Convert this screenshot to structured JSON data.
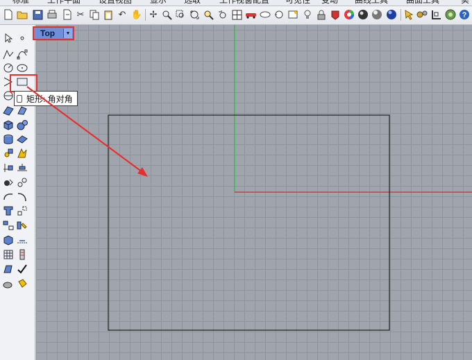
{
  "tabs": [
    "标准",
    "工作平面",
    "设置视图",
    "显示",
    "选取",
    "工作视窗配置",
    "可见性",
    "变动",
    "曲线工具",
    "曲面工具",
    "实"
  ],
  "toolbar_icons": [
    "new-file-icon",
    "open-file-icon",
    "save-icon",
    "print-icon",
    "import-icon",
    "cut-icon",
    "copy-icon",
    "paste-icon",
    "undo-icon",
    "pan-icon",
    "rotate-view-icon",
    "zoom-icon",
    "zoom-window-icon",
    "zoom-extents-icon",
    "zoom-selected-icon",
    "undo-view-icon",
    "four-viewports-icon",
    "car-icon",
    "hide-icon",
    "show-icon",
    "layer-icon",
    "light-icon",
    "lock-icon",
    "material-icon",
    "color-wheel-icon",
    "render-icon",
    "sphere-icon",
    "render-sphere-icon",
    "lightbulb-icon",
    "options-icon",
    "snap-icon",
    "grasshopper-icon",
    "help-icon"
  ],
  "left_toolbar_icons": [
    "select-arrow-icon",
    "point-icon",
    "polyline-icon",
    "control-point-curve-icon",
    "circle-icon",
    "ellipse-icon",
    "arc-icon",
    "rectangle-icon",
    "polygon-icon",
    "sweep-icon",
    "surface-icon",
    "box-icon",
    "sphere-solid-icon",
    "extrude-icon",
    "loft-icon",
    "fillet-icon",
    "boolean-icon",
    "trim-icon",
    "split-icon",
    "join-icon",
    "explode-icon",
    "group-icon",
    "text-icon",
    "dimension-icon",
    "transform-icon",
    "array-icon",
    "mirror-icon",
    "scale-icon",
    "grid-icon",
    "analyze-icon",
    "check-icon",
    "render-mesh-icon",
    "layer-edit-icon"
  ],
  "viewport": {
    "label": "Top",
    "dropdown_symbol": "▼"
  },
  "tooltip": {
    "text": "矩形: 角对角"
  },
  "colors": {
    "annotation": "#e53030",
    "x_axis": "#c83232",
    "y_axis": "#3ab84a",
    "viewport_bg": "#a0a5ad",
    "grid": "#8f949c",
    "rectangle": "#1e1e1e"
  }
}
